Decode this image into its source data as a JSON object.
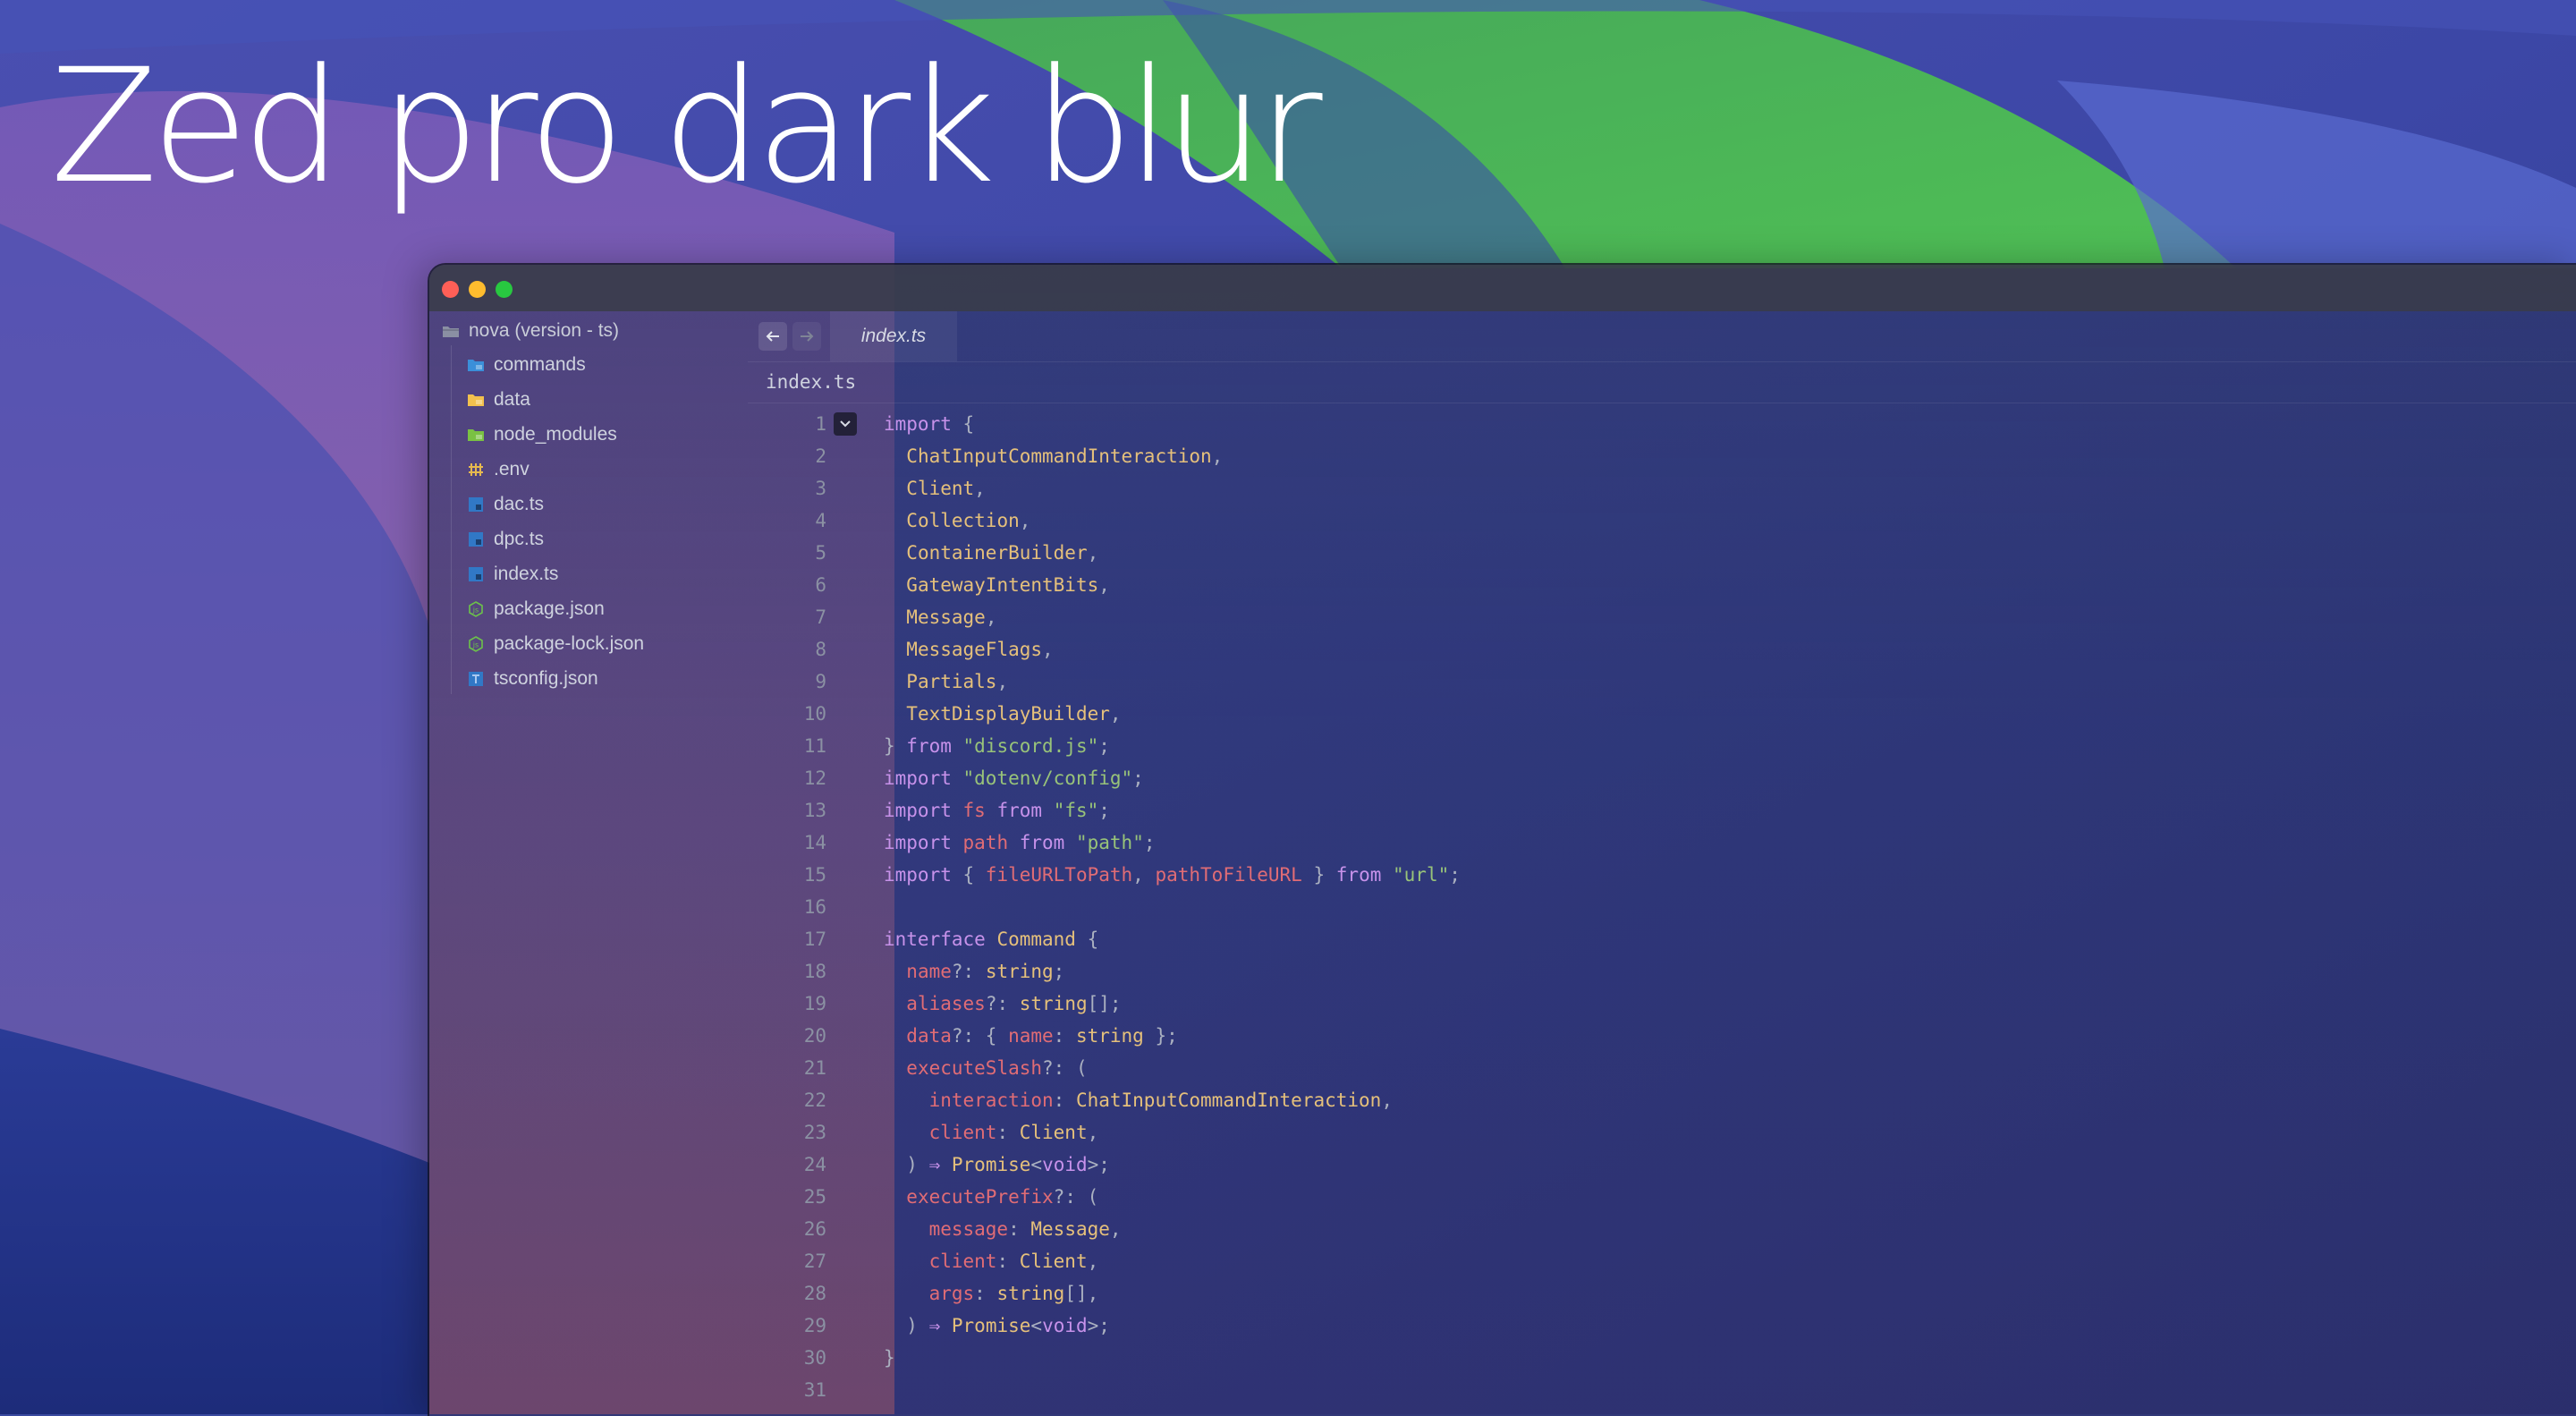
{
  "promo": {
    "title": "Zed pro dark blur"
  },
  "colors": {
    "keyword": "#c792ea",
    "type": "#e5c07b",
    "string": "#98c379",
    "property": "#e06c75",
    "plain": "#c6cbd8",
    "punctuation": "#aab0c0",
    "traffic_close": "#ff5f57",
    "traffic_minimize": "#febc2e",
    "traffic_maximize": "#28c840"
  },
  "window": {
    "traffic_lights": [
      "close",
      "minimize",
      "maximize"
    ]
  },
  "sidebar": {
    "root": {
      "label": "nova (version - ts)",
      "icon": "folder-open-icon"
    },
    "items": [
      {
        "label": "commands",
        "icon": "folder-icon",
        "color": "#3b8fd9"
      },
      {
        "label": "data",
        "icon": "folder-icon",
        "color": "#f2c14e"
      },
      {
        "label": "node_modules",
        "icon": "folder-icon",
        "color": "#7ac143"
      },
      {
        "label": ".env",
        "icon": "env-file-icon",
        "color": "#e6b94f"
      },
      {
        "label": "dac.ts",
        "icon": "typescript-file-icon",
        "color": "#3178c6"
      },
      {
        "label": "dpc.ts",
        "icon": "typescript-file-icon",
        "color": "#3178c6"
      },
      {
        "label": "index.ts",
        "icon": "typescript-file-icon",
        "color": "#3178c6"
      },
      {
        "label": "package.json",
        "icon": "nodejs-file-icon",
        "color": "#6cc24a"
      },
      {
        "label": "package-lock.json",
        "icon": "nodejs-file-icon",
        "color": "#6cc24a"
      },
      {
        "label": "tsconfig.json",
        "icon": "tsconfig-file-icon",
        "color": "#3178c6"
      }
    ]
  },
  "editor": {
    "nav": {
      "back_icon": "arrow-left-icon",
      "forward_icon": "arrow-right-icon"
    },
    "active_tab": "index.ts",
    "breadcrumb": "index.ts",
    "lines": [
      {
        "n": "1",
        "tokens": [
          [
            "import",
            "kw"
          ],
          [
            " {",
            "pu"
          ]
        ]
      },
      {
        "n": "2",
        "tokens": [
          [
            "  ",
            "pl"
          ],
          [
            "ChatInputCommandInteraction",
            "ty"
          ],
          [
            ",",
            "pu"
          ]
        ]
      },
      {
        "n": "3",
        "tokens": [
          [
            "  ",
            "pl"
          ],
          [
            "Client",
            "ty"
          ],
          [
            ",",
            "pu"
          ]
        ]
      },
      {
        "n": "4",
        "tokens": [
          [
            "  ",
            "pl"
          ],
          [
            "Collection",
            "ty"
          ],
          [
            ",",
            "pu"
          ]
        ]
      },
      {
        "n": "5",
        "tokens": [
          [
            "  ",
            "pl"
          ],
          [
            "ContainerBuilder",
            "ty"
          ],
          [
            ",",
            "pu"
          ]
        ]
      },
      {
        "n": "6",
        "tokens": [
          [
            "  ",
            "pl"
          ],
          [
            "GatewayIntentBits",
            "ty"
          ],
          [
            ",",
            "pu"
          ]
        ]
      },
      {
        "n": "7",
        "tokens": [
          [
            "  ",
            "pl"
          ],
          [
            "Message",
            "ty"
          ],
          [
            ",",
            "pu"
          ]
        ]
      },
      {
        "n": "8",
        "tokens": [
          [
            "  ",
            "pl"
          ],
          [
            "MessageFlags",
            "ty"
          ],
          [
            ",",
            "pu"
          ]
        ]
      },
      {
        "n": "9",
        "tokens": [
          [
            "  ",
            "pl"
          ],
          [
            "Partials",
            "ty"
          ],
          [
            ",",
            "pu"
          ]
        ]
      },
      {
        "n": "10",
        "tokens": [
          [
            "  ",
            "pl"
          ],
          [
            "TextDisplayBuilder",
            "ty"
          ],
          [
            ",",
            "pu"
          ]
        ]
      },
      {
        "n": "11",
        "tokens": [
          [
            "} ",
            "pu"
          ],
          [
            "from",
            "kw"
          ],
          [
            " ",
            "pl"
          ],
          [
            "\"discord.js\"",
            "str"
          ],
          [
            ";",
            "pu"
          ]
        ]
      },
      {
        "n": "12",
        "tokens": [
          [
            "import",
            "kw"
          ],
          [
            " ",
            "pl"
          ],
          [
            "\"dotenv/config\"",
            "str"
          ],
          [
            ";",
            "pu"
          ]
        ]
      },
      {
        "n": "13",
        "tokens": [
          [
            "import",
            "kw"
          ],
          [
            " ",
            "pl"
          ],
          [
            "fs",
            "prop"
          ],
          [
            " ",
            "pl"
          ],
          [
            "from",
            "kw"
          ],
          [
            " ",
            "pl"
          ],
          [
            "\"fs\"",
            "str"
          ],
          [
            ";",
            "pu"
          ]
        ]
      },
      {
        "n": "14",
        "tokens": [
          [
            "import",
            "kw"
          ],
          [
            " ",
            "pl"
          ],
          [
            "path",
            "prop"
          ],
          [
            " ",
            "pl"
          ],
          [
            "from",
            "kw"
          ],
          [
            " ",
            "pl"
          ],
          [
            "\"path\"",
            "str"
          ],
          [
            ";",
            "pu"
          ]
        ]
      },
      {
        "n": "15",
        "tokens": [
          [
            "import",
            "kw"
          ],
          [
            " { ",
            "pu"
          ],
          [
            "fileURLToPath",
            "prop"
          ],
          [
            ", ",
            "pu"
          ],
          [
            "pathToFileURL",
            "prop"
          ],
          [
            " } ",
            "pu"
          ],
          [
            "from",
            "kw"
          ],
          [
            " ",
            "pl"
          ],
          [
            "\"url\"",
            "str"
          ],
          [
            ";",
            "pu"
          ]
        ]
      },
      {
        "n": "16",
        "tokens": []
      },
      {
        "n": "17",
        "tokens": [
          [
            "interface",
            "kw"
          ],
          [
            " ",
            "pl"
          ],
          [
            "Command",
            "ty"
          ],
          [
            " {",
            "pu"
          ]
        ]
      },
      {
        "n": "18",
        "tokens": [
          [
            "  ",
            "pl"
          ],
          [
            "name",
            "prop"
          ],
          [
            "?: ",
            "pu"
          ],
          [
            "string",
            "ty"
          ],
          [
            ";",
            "pu"
          ]
        ]
      },
      {
        "n": "19",
        "tokens": [
          [
            "  ",
            "pl"
          ],
          [
            "aliases",
            "prop"
          ],
          [
            "?: ",
            "pu"
          ],
          [
            "string",
            "ty"
          ],
          [
            "[];",
            "pu"
          ]
        ]
      },
      {
        "n": "20",
        "tokens": [
          [
            "  ",
            "pl"
          ],
          [
            "data",
            "prop"
          ],
          [
            "?: { ",
            "pu"
          ],
          [
            "name",
            "prop"
          ],
          [
            ": ",
            "pu"
          ],
          [
            "string",
            "ty"
          ],
          [
            " };",
            "pu"
          ]
        ]
      },
      {
        "n": "21",
        "tokens": [
          [
            "  ",
            "pl"
          ],
          [
            "executeSlash",
            "prop"
          ],
          [
            "?: (",
            "pu"
          ]
        ]
      },
      {
        "n": "22",
        "tokens": [
          [
            "    ",
            "pl"
          ],
          [
            "interaction",
            "prop"
          ],
          [
            ": ",
            "pu"
          ],
          [
            "ChatInputCommandInteraction",
            "ty"
          ],
          [
            ",",
            "pu"
          ]
        ]
      },
      {
        "n": "23",
        "tokens": [
          [
            "    ",
            "pl"
          ],
          [
            "client",
            "prop"
          ],
          [
            ": ",
            "pu"
          ],
          [
            "Client",
            "ty"
          ],
          [
            ",",
            "pu"
          ]
        ]
      },
      {
        "n": "24",
        "tokens": [
          [
            "  ) ",
            "pu"
          ],
          [
            "⇒",
            "kw"
          ],
          [
            " ",
            "pl"
          ],
          [
            "Promise",
            "ty"
          ],
          [
            "<",
            "pu"
          ],
          [
            "void",
            "kw"
          ],
          [
            ">;",
            "pu"
          ]
        ]
      },
      {
        "n": "25",
        "tokens": [
          [
            "  ",
            "pl"
          ],
          [
            "executePrefix",
            "prop"
          ],
          [
            "?: (",
            "pu"
          ]
        ]
      },
      {
        "n": "26",
        "tokens": [
          [
            "    ",
            "pl"
          ],
          [
            "message",
            "prop"
          ],
          [
            ": ",
            "pu"
          ],
          [
            "Message",
            "ty"
          ],
          [
            ",",
            "pu"
          ]
        ]
      },
      {
        "n": "27",
        "tokens": [
          [
            "    ",
            "pl"
          ],
          [
            "client",
            "prop"
          ],
          [
            ": ",
            "pu"
          ],
          [
            "Client",
            "ty"
          ],
          [
            ",",
            "pu"
          ]
        ]
      },
      {
        "n": "28",
        "tokens": [
          [
            "    ",
            "pl"
          ],
          [
            "args",
            "prop"
          ],
          [
            ": ",
            "pu"
          ],
          [
            "string",
            "ty"
          ],
          [
            "[],",
            "pu"
          ]
        ]
      },
      {
        "n": "29",
        "tokens": [
          [
            "  ) ",
            "pu"
          ],
          [
            "⇒",
            "kw"
          ],
          [
            " ",
            "pl"
          ],
          [
            "Promise",
            "ty"
          ],
          [
            "<",
            "pu"
          ],
          [
            "void",
            "kw"
          ],
          [
            ">;",
            "pu"
          ]
        ]
      },
      {
        "n": "30",
        "tokens": [
          [
            "}",
            "pu"
          ]
        ]
      },
      {
        "n": "31",
        "tokens": []
      }
    ]
  }
}
